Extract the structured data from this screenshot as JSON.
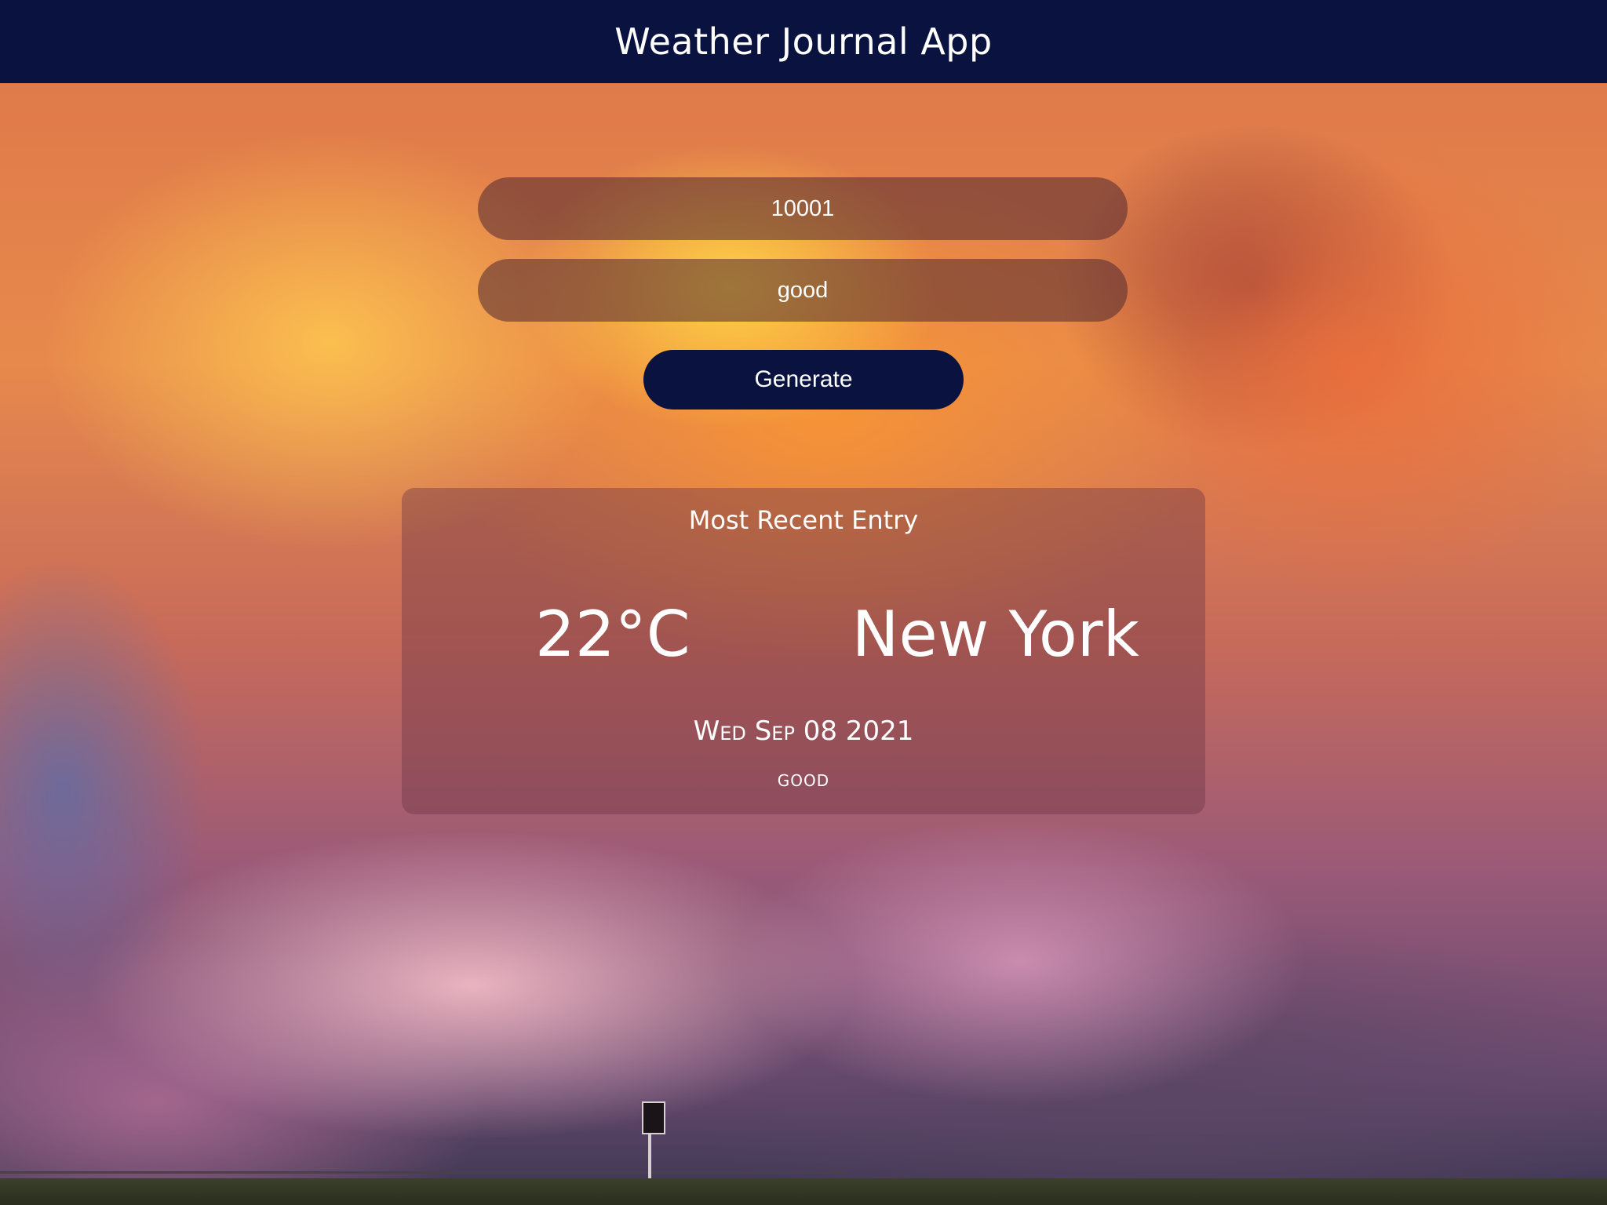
{
  "header": {
    "title": "Weather Journal App"
  },
  "form": {
    "zip_value": "10001",
    "feelings_value": "good",
    "generate_label": "Generate"
  },
  "entry": {
    "title": "Most Recent Entry",
    "temperature": "22°C",
    "city": "New York",
    "date": "Wed Sep 08 2021",
    "feeling": "good"
  }
}
